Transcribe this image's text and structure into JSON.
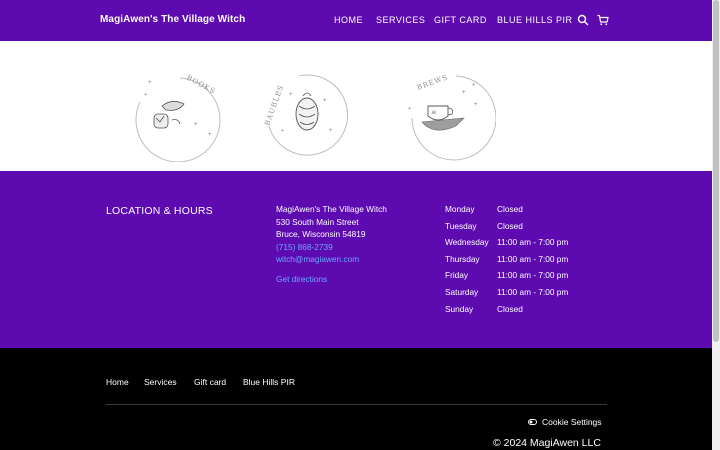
{
  "header": {
    "brand": "MagiAwen's The Village Witch",
    "nav": [
      "HOME",
      "SERVICES",
      "GIFT CARD",
      "BLUE HILLS PIR"
    ],
    "icons": [
      "search-icon",
      "cart-icon"
    ]
  },
  "gallery": {
    "badges": [
      {
        "label": "BOOKS",
        "icon": "book-crystal-icon"
      },
      {
        "label": "BAUBLES",
        "icon": "jewelry-icon"
      },
      {
        "label": "BREWS",
        "icon": "teacup-icon"
      }
    ]
  },
  "location": {
    "title": "LOCATION & HOURS",
    "business_name": "MagiAwen's The Village Witch",
    "street": "530 South Main Street",
    "city_line": "Bruce, Wisconsin 54819",
    "phone": "(715) 868-2739",
    "email": "witch@magiawen.com",
    "directions": "Get directions"
  },
  "hours": [
    {
      "day": "Monday",
      "time": "Closed"
    },
    {
      "day": "Tuesday",
      "time": "Closed"
    },
    {
      "day": "Wednesday",
      "time": "11:00 am - 7:00 pm"
    },
    {
      "day": "Thursday",
      "time": "11:00 am - 7:00 pm"
    },
    {
      "day": "Friday",
      "time": "11:00 am - 7:00 pm"
    },
    {
      "day": "Saturday",
      "time": "11:00 am - 7:00 pm"
    },
    {
      "day": "Sunday",
      "time": "Closed"
    }
  ],
  "footer": {
    "links": [
      "Home",
      "Services",
      "Gift card",
      "Blue Hills PIR"
    ],
    "cookie": "Cookie Settings",
    "copyright": "© 2024 MagiAwen LLC"
  },
  "colors": {
    "brand_purple": "#5d0ab1",
    "link_blue": "#6aa8ff",
    "footer_bg": "#000000"
  }
}
